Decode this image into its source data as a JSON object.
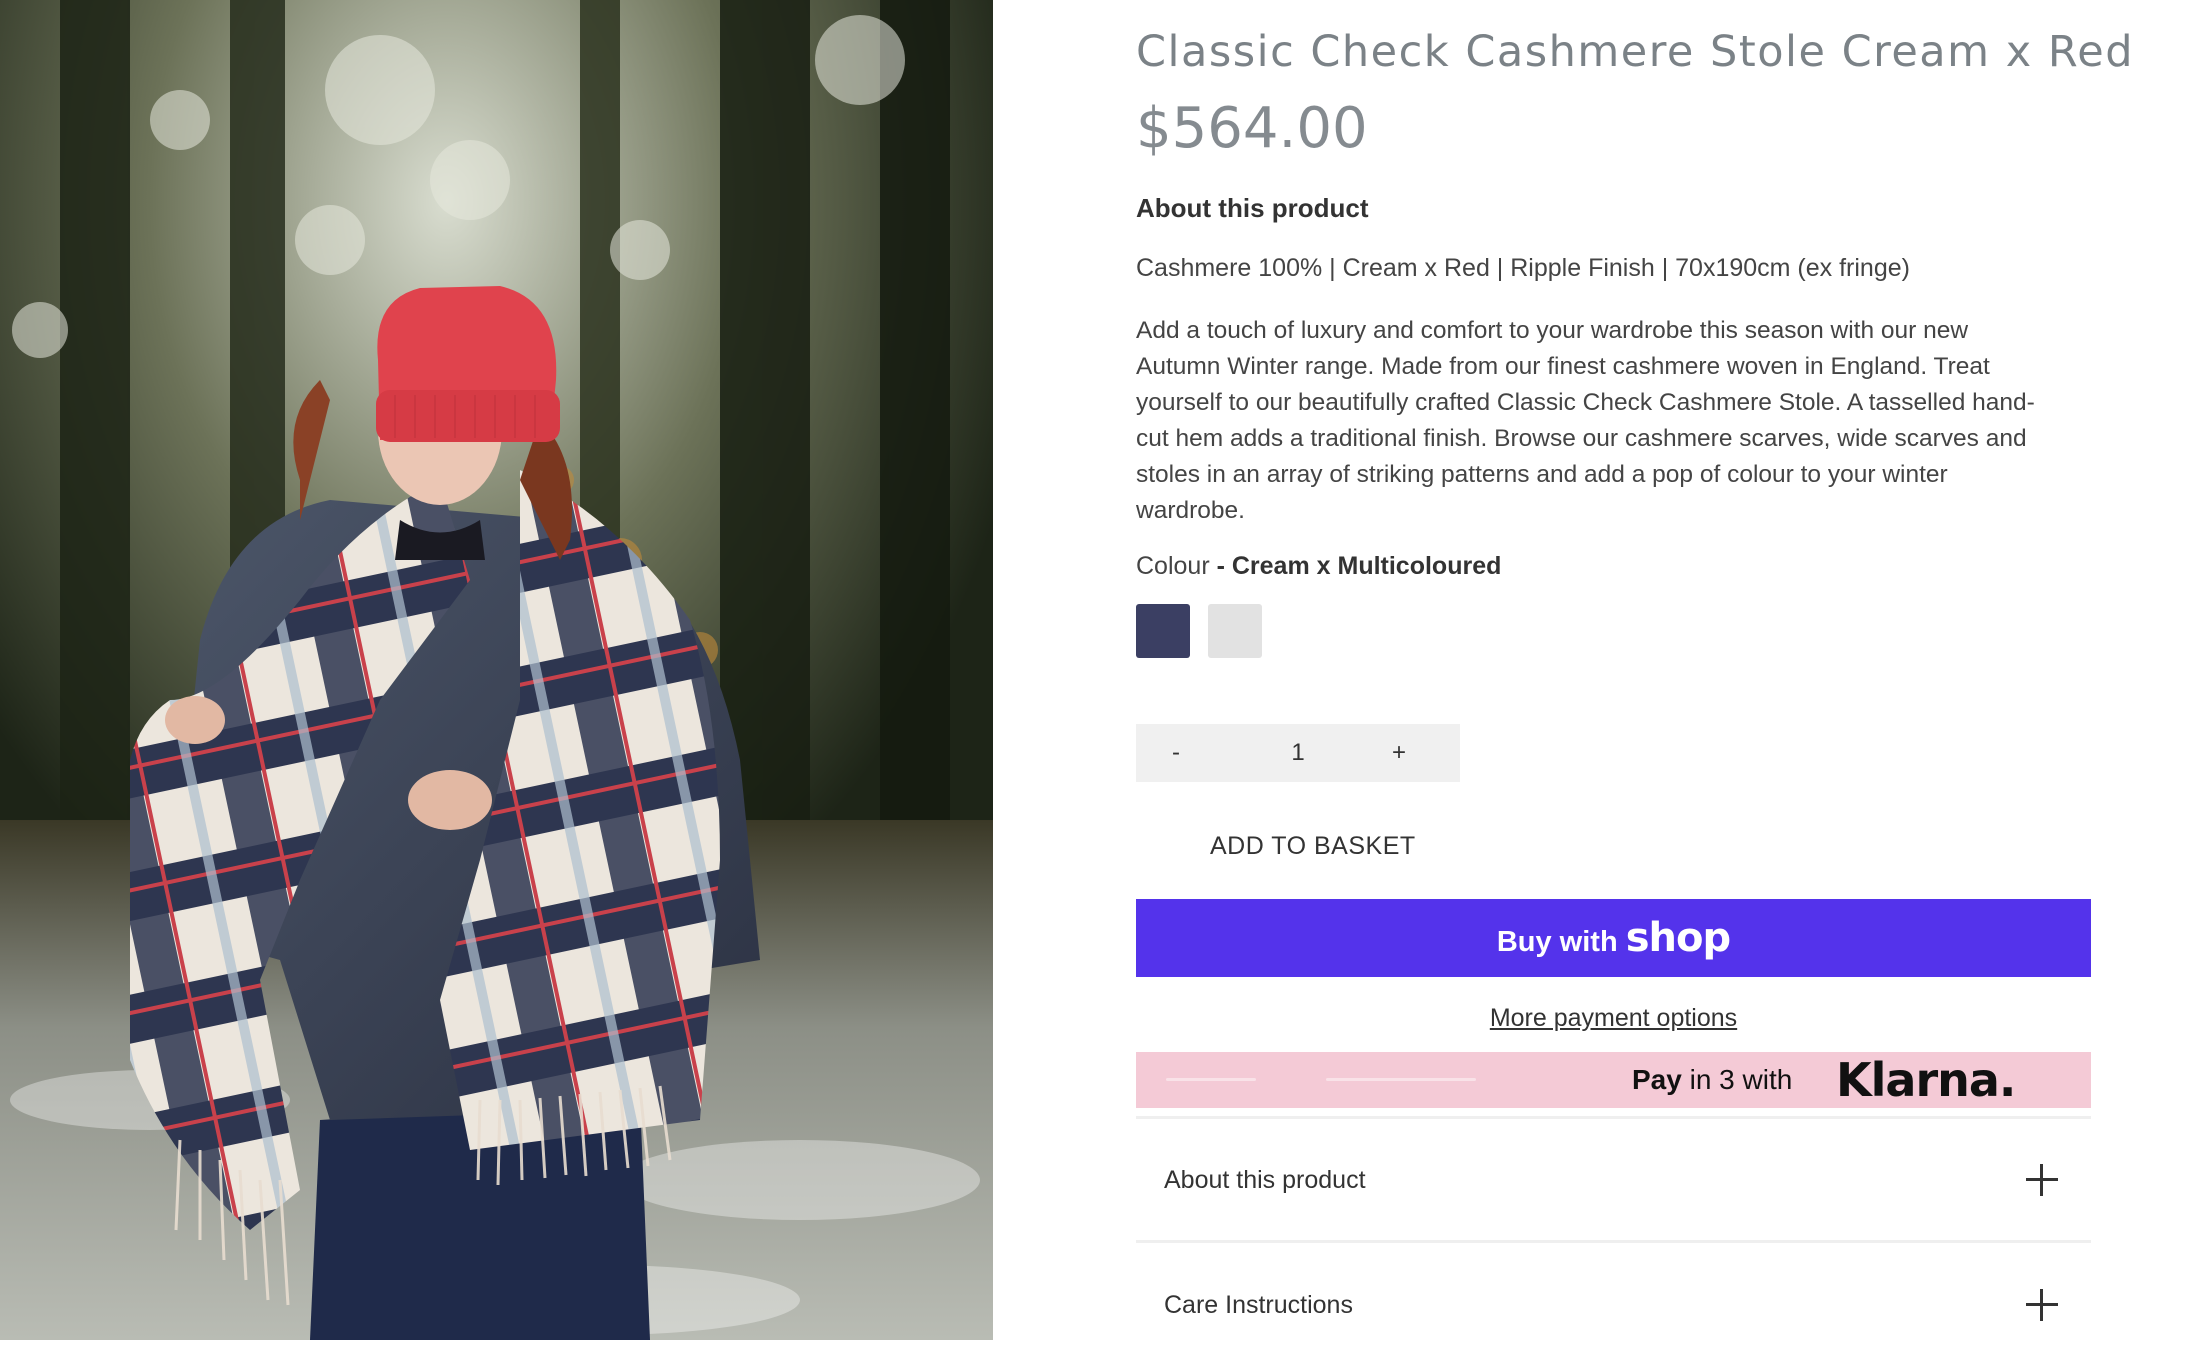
{
  "product": {
    "image_alt": "Woman in a red beanie wearing a checked cashmere stole outdoors",
    "title": "Classic Check Cashmere Stole Cream x Red",
    "price": "$564.00"
  },
  "about": {
    "heading": "About this product",
    "spec_line": "Cashmere 100% | Cream x Red | Ripple Finish | 70x190cm (ex fringe)",
    "description": "Add a touch of luxury and comfort to your wardrobe this season with our new Autumn Winter range. Made from our finest cashmere woven in England. Treat yourself to our beautifully crafted Classic Check Cashmere Stole. A tasselled hand-cut hem adds a traditional finish. Browse our cashmere scarves, wide scarves and stoles in an array of striking patterns and add a pop of colour to your winter wardrobe."
  },
  "colour": {
    "label": "Colour",
    "separator": " - ",
    "selected": "Cream x Multicoloured",
    "swatches": [
      {
        "name": "navy",
        "color": "#3b3f63"
      },
      {
        "name": "cream",
        "color": "#e2e2e2"
      }
    ]
  },
  "quantity": {
    "minus": "-",
    "value": "1",
    "plus": "+"
  },
  "actions": {
    "add_to_basket": "ADD TO BASKET",
    "buy_with": "Buy with",
    "shop_word": "shop",
    "more_payment": "More payment options",
    "buy_color": "#5433eb"
  },
  "klarna": {
    "pay": "Pay",
    "in_3_with": "in 3 with",
    "logo": "Klarna.",
    "background": "#f4cad6"
  },
  "accordions": [
    {
      "label": "About this product",
      "icon": "plus-icon"
    },
    {
      "label": "Care Instructions",
      "icon": "plus-icon"
    }
  ]
}
